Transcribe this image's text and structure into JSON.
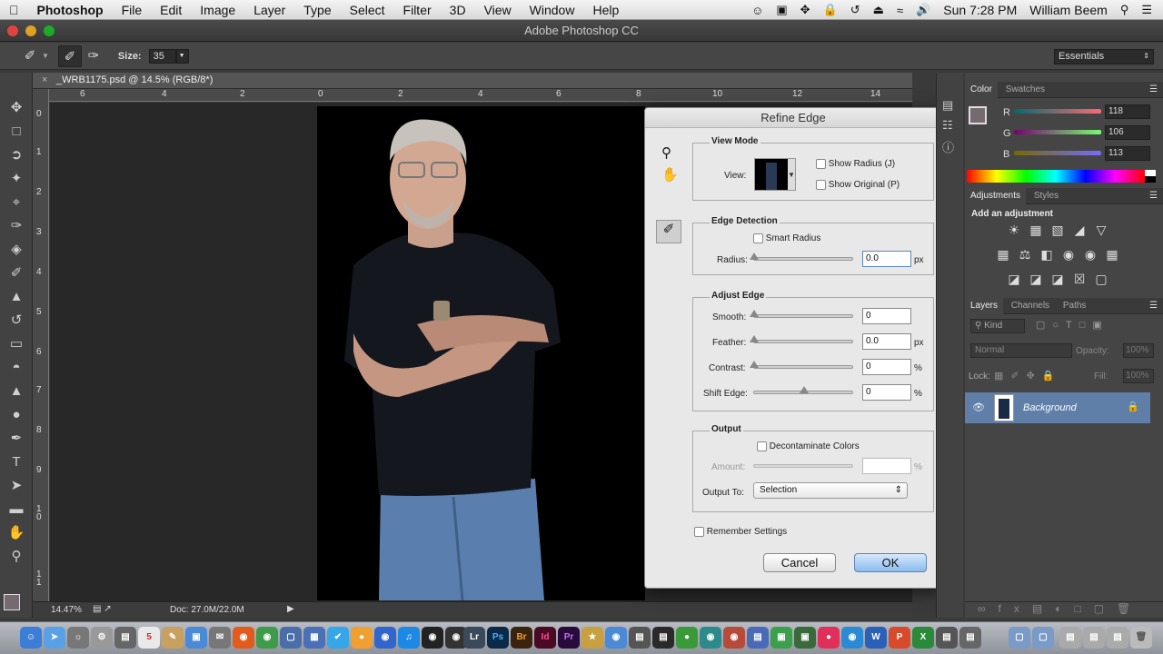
{
  "menubar": {
    "app_name": "Photoshop",
    "items": [
      "File",
      "Edit",
      "Image",
      "Layer",
      "Type",
      "Select",
      "Filter",
      "3D",
      "View",
      "Window",
      "Help"
    ],
    "clock": "Sun 7:28 PM",
    "user": "William Beem"
  },
  "window": {
    "title": "Adobe Photoshop CC"
  },
  "options_bar": {
    "size_label": "Size:",
    "size_value": "35",
    "workspace": "Essentials"
  },
  "document": {
    "tab_title": "_WRB1175.psd @ 14.5% (RGB/8*)",
    "ruler_top": [
      "6",
      "4",
      "2",
      "0",
      "2",
      "4",
      "6",
      "8",
      "10",
      "12",
      "14"
    ],
    "ruler_left": [
      "0",
      "1",
      "2",
      "3",
      "4",
      "5",
      "6",
      "7",
      "8",
      "9",
      "1 0",
      "1 1"
    ],
    "zoom": "14.47%",
    "doc_info": "Doc: 27.0M/22.0M"
  },
  "refine_edge": {
    "title": "Refine Edge",
    "view_mode": {
      "label": "View Mode",
      "view_label": "View:",
      "show_radius": "Show Radius (J)",
      "show_original": "Show Original (P)"
    },
    "edge_detection": {
      "label": "Edge Detection",
      "smart_radius": "Smart Radius",
      "radius_label": "Radius:",
      "radius_value": "0.0",
      "radius_unit": "px"
    },
    "adjust_edge": {
      "label": "Adjust Edge",
      "smooth_label": "Smooth:",
      "smooth_value": "0",
      "feather_label": "Feather:",
      "feather_value": "0.0",
      "feather_unit": "px",
      "contrast_label": "Contrast:",
      "contrast_value": "0",
      "contrast_unit": "%",
      "shift_label": "Shift Edge:",
      "shift_value": "0",
      "shift_unit": "%"
    },
    "output": {
      "label": "Output",
      "decontaminate": "Decontaminate Colors",
      "amount_label": "Amount:",
      "amount_unit": "%",
      "output_to_label": "Output To:",
      "output_to_value": "Selection"
    },
    "remember": "Remember Settings",
    "cancel": "Cancel",
    "ok": "OK"
  },
  "color_panel": {
    "tabs": [
      "Color",
      "Swatches"
    ],
    "r_label": "R",
    "r_value": "118",
    "g_label": "G",
    "g_value": "106",
    "b_label": "B",
    "b_value": "113",
    "fg_color": "#766a71"
  },
  "adjustments_panel": {
    "tabs": [
      "Adjustments",
      "Styles"
    ],
    "heading": "Add an adjustment"
  },
  "layers_panel": {
    "tabs": [
      "Layers",
      "Channels",
      "Paths"
    ],
    "kind": "Kind",
    "blend_mode": "Normal",
    "opacity_label": "Opacity:",
    "opacity_value": "100%",
    "lock_label": "Lock:",
    "fill_label": "Fill:",
    "fill_value": "100%",
    "layer_name": "Background"
  },
  "dock": {
    "labels": [
      "5",
      "Lr",
      "Ps",
      "Br",
      "Id",
      "Pr"
    ]
  }
}
